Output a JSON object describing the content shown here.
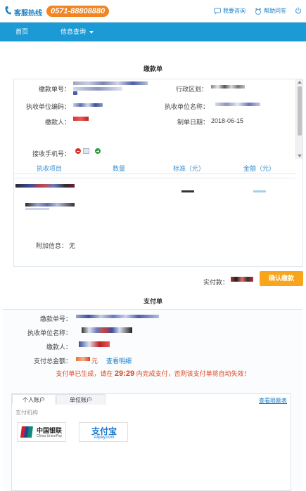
{
  "header": {
    "hotline_label": "客服热线",
    "hotline_number": "0571-88808880",
    "links": [
      {
        "label": "我要咨询",
        "icon": "chat-icon"
      },
      {
        "label": "帮助问答",
        "icon": "help-icon"
      },
      {
        "label": "退出",
        "icon": "power-icon"
      }
    ]
  },
  "nav": {
    "home": "首页",
    "info_query": "信息查询"
  },
  "notice": {
    "title": "缴款单",
    "fields": {
      "payment_no_label": "缴款单号：",
      "region_label": "行政区划：",
      "unit_code_label": "执收单位编码：",
      "unit_name_label": "执收单位名称：",
      "payer_label": "缴款人：",
      "date_label": "制单日期：",
      "date_value": "2018-06-15",
      "phone_label": "接收手机号："
    },
    "table_headers": [
      "执收项目",
      "数量",
      "标准（元）",
      "金额（元）"
    ],
    "extra_label": "附加信息：",
    "extra_value": "无",
    "paid_label": "实付款：",
    "confirm_button": "确认缴款"
  },
  "payment": {
    "title": "支付单",
    "payment_no_label": "缴款单号：",
    "unit_name_label": "执收单位名称：",
    "payer_label": "缴款人：",
    "total_label": "支付总金额：",
    "total_unit": "元",
    "detail_link": "查看明细",
    "timer_prefix": "支付单已生成，请在",
    "timer_value": "29:29",
    "timer_suffix": "内完成支付，否则该支付单将自动失效！",
    "tabs": [
      "个人账户",
      "单位账户"
    ],
    "limit_link": "查看限额表",
    "org_label": "支付机构",
    "banks": [
      {
        "name_cn": "中国银联",
        "name_en": "China UnionPay"
      },
      {
        "name_cn": "支付宝",
        "name_en": "Alipay.com"
      }
    ]
  },
  "colors": {
    "nav_bg": "#1b9ad6",
    "accent_orange": "#f7a51c",
    "link_blue": "#1a7fc6",
    "warning_red": "#e0431a"
  }
}
